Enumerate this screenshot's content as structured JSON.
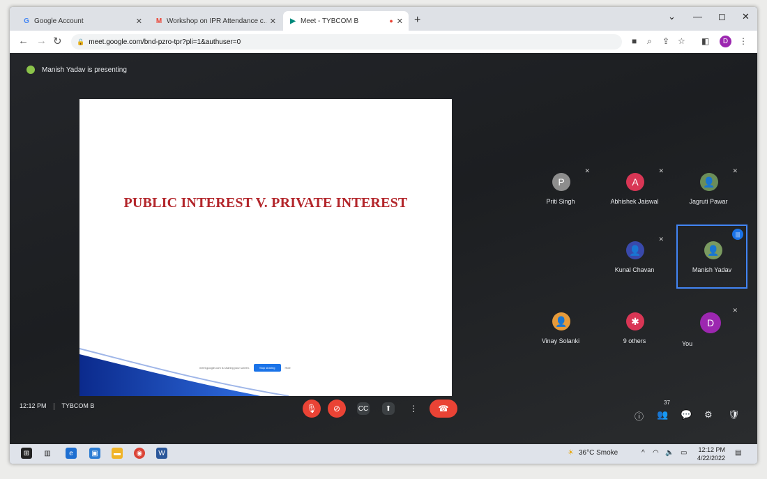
{
  "browser": {
    "tabs": [
      {
        "label": "Google Account",
        "icon": "G"
      },
      {
        "label": "Workshop on IPR Attendance c...",
        "icon": "M"
      },
      {
        "label": "Meet - TYBCOM B",
        "icon": "▶"
      }
    ],
    "url": "meet.google.com/bnd-pzro-tpr?pli=1&authuser=0",
    "profile_letter": "D"
  },
  "meet": {
    "presenting_text": "Manish Yadav is presenting",
    "slide_title": "PUBLIC INTEREST V. PRIVATE INTEREST",
    "share_bar_text": "meet.google.com is sharing your screen.",
    "share_stop_label": "Stop sharing",
    "share_hide_label": "Hide",
    "participants": [
      {
        "name": "Priti Singh",
        "letter": "P",
        "color": "#8d8d8d"
      },
      {
        "name": "Abhishek Jaiswal",
        "letter": "A",
        "color": "#d93655"
      },
      {
        "name": "Jagruti Pawar",
        "letter": "",
        "color": "#6b8e5a"
      },
      {
        "name": "Kunal Chavan",
        "letter": "",
        "color": "#3949ab"
      },
      {
        "name": "Manish Yadav",
        "letter": "",
        "color": "#7a9a60"
      },
      {
        "name": "Vinay Solanki",
        "letter": "",
        "color": "#e59a3a"
      },
      {
        "name": "9 others",
        "letter": "",
        "color": "#d93655"
      },
      {
        "name": "You",
        "letter": "D",
        "color": "#9c27b0"
      }
    ],
    "time": "12:12 PM",
    "meeting_name": "TYBCOM B",
    "participant_count": "37"
  },
  "taskbar": {
    "weather": "36°C Smoke",
    "time": "12:12 PM",
    "date": "4/22/2022"
  }
}
